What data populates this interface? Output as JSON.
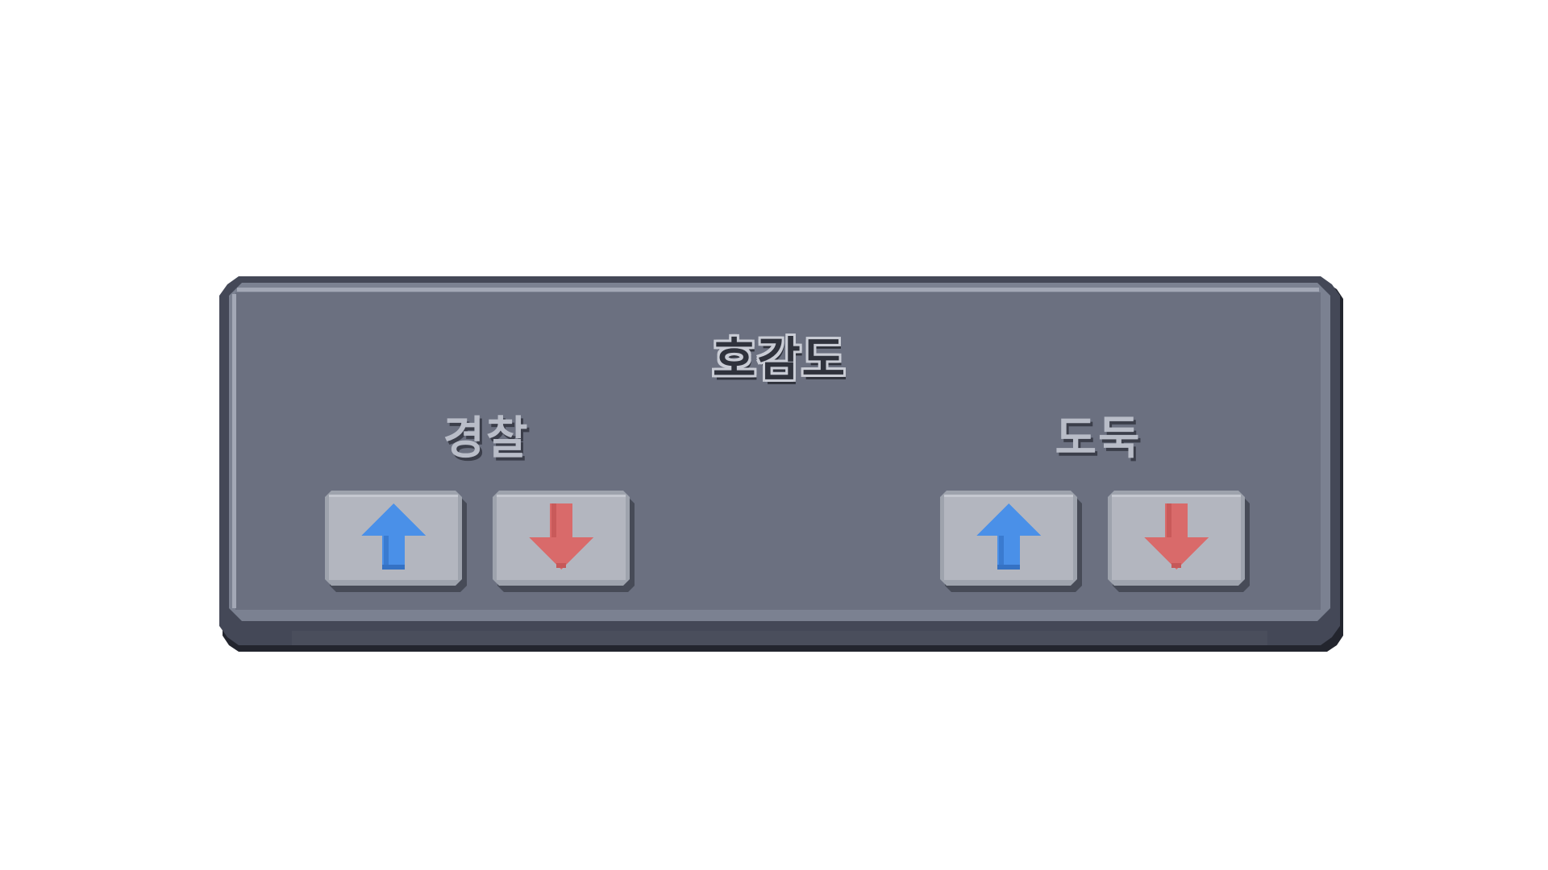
{
  "panel": {
    "title": "호감도",
    "colors": {
      "panel_body": "#6b7080",
      "panel_shadow": "#23252e",
      "button_face": "#b3b6bf",
      "up_arrow": "#4a90e8",
      "down_arrow": "#d96a6a"
    },
    "groups": [
      {
        "label": "경찰",
        "buttons": [
          {
            "icon": "arrow-up-icon"
          },
          {
            "icon": "arrow-down-icon"
          }
        ]
      },
      {
        "label": "도둑",
        "buttons": [
          {
            "icon": "arrow-up-icon"
          },
          {
            "icon": "arrow-down-icon"
          }
        ]
      }
    ]
  }
}
